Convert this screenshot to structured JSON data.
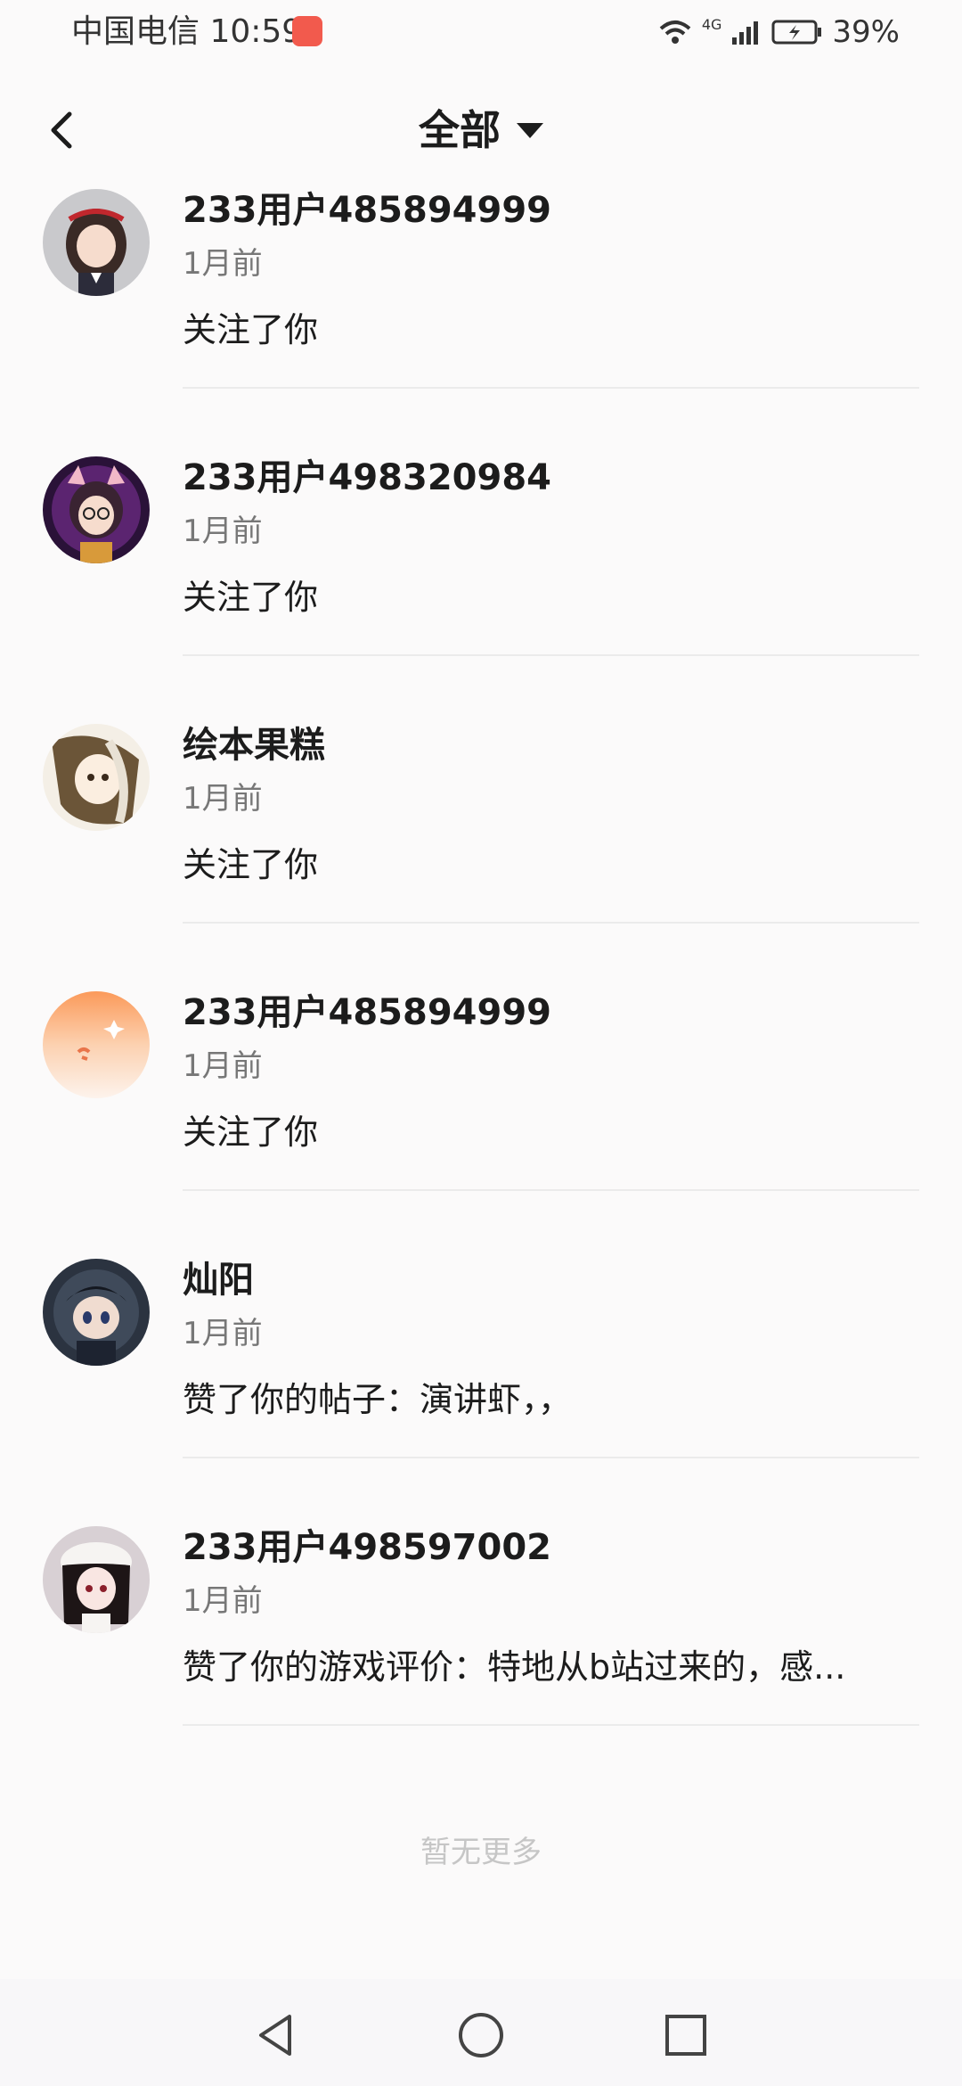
{
  "status_bar": {
    "carrier_time": "中国电信 10:59",
    "network": "4G",
    "battery": "39%"
  },
  "header": {
    "title": "全部",
    "back_icon": "back-arrow-icon",
    "dropdown_icon": "dropdown-caret-icon"
  },
  "notifications": [
    {
      "name": "233用户485894999",
      "time": "1月前",
      "content": "关注了你",
      "avatar": "avatar-girl-red-headband"
    },
    {
      "name": "233用户498320984",
      "time": "1月前",
      "content": "关注了你",
      "avatar": "avatar-cat-ear-glasses"
    },
    {
      "name": "绘本果糕",
      "time": "1月前",
      "content": "关注了你",
      "avatar": "avatar-anime-sketch"
    },
    {
      "name": "233用户485894999",
      "time": "1月前",
      "content": "关注了你",
      "avatar": "avatar-default-orange"
    },
    {
      "name": "灿阳",
      "time": "1月前",
      "content": "赞了你的帖子：演讲虾，，",
      "avatar": "avatar-dark-chibi"
    },
    {
      "name": "233用户498597002",
      "time": "1月前",
      "content": "赞了你的游戏评价：特地从b站过来的，感...",
      "avatar": "avatar-girl-white-hat"
    }
  ],
  "footer": {
    "no_more": "暂无更多"
  },
  "nav": {
    "back_icon": "triangle-back-icon",
    "home_icon": "circle-home-icon",
    "recent_icon": "square-recent-icon"
  }
}
